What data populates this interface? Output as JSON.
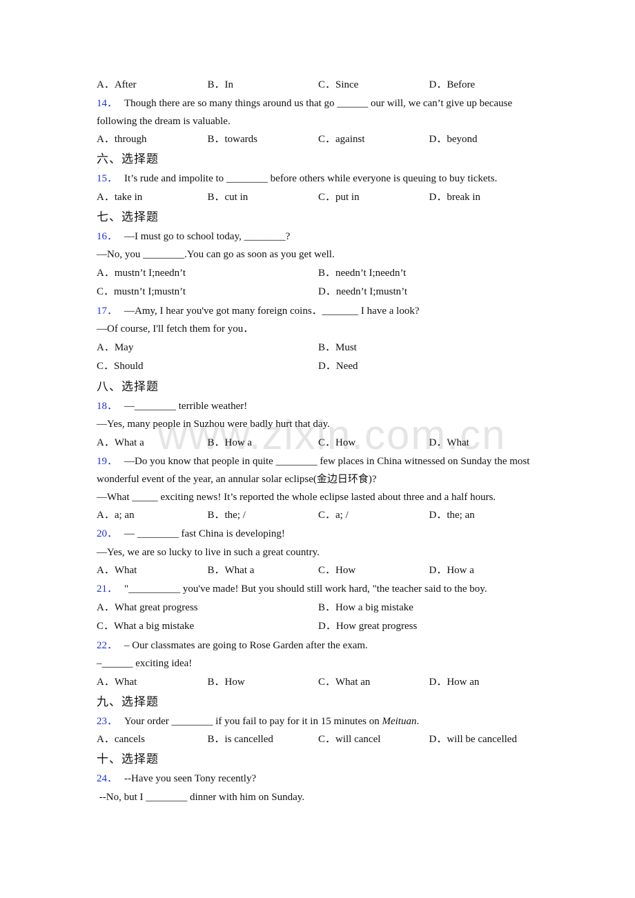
{
  "watermark": "www.zixin.com.cn",
  "q13_options": [
    "A．After",
    "B．In",
    "C．Since",
    "D．Before"
  ],
  "sections": {
    "six": "六、选择题",
    "seven": "七、选择题",
    "eight": "八、选择题",
    "nine": "九、选择题",
    "ten": "十、选择题"
  },
  "questions": {
    "q14": {
      "num": "14．",
      "text": "Though there are so many things around us that go ______ our will, we can’t give up because following the dream is valuable.",
      "options": [
        "A．through",
        "B．towards",
        "C．against",
        "D．beyond"
      ]
    },
    "q15": {
      "num": "15．",
      "text": "It’s rude and impolite to ________ before others while everyone is queuing to buy tickets.",
      "options": [
        "A．take in",
        "B．cut in",
        "C．put in",
        "D．break in"
      ]
    },
    "q16": {
      "num": "16．",
      "line1": "—I must go to school today, ________?",
      "line2": "—No, you ________.You can go as soon as you get well.",
      "options": [
        "A．mustn’t I;needn’t",
        "B．needn’t I;needn’t",
        "C．mustn’t I;mustn’t",
        "D．needn’t I;mustn’t"
      ]
    },
    "q17": {
      "num": "17．",
      "line1": "—Amy, I hear you've got many foreign coins．_______ I have a look?",
      "line2": "—Of course, I'll fetch them for you．",
      "options": [
        "A．May",
        "B．Must",
        "C．Should",
        "D．Need"
      ]
    },
    "q18": {
      "num": "18．",
      "line1": "—________ terrible weather!",
      "line2": "—Yes, many people in Suzhou were badly hurt that day.",
      "options": [
        "A．What a",
        "B．How a",
        "C．How",
        "D．What"
      ]
    },
    "q19": {
      "num": "19．",
      "line1": "—Do you know that people in quite ________ few places in China witnessed on Sunday the most wonderful event of the year, an annular solar eclipse(金边日环食)?",
      "line2": "—What _____ exciting news! It’s reported the whole eclipse lasted about three and a half hours.",
      "options": [
        "A．a; an",
        "B．the; /",
        "C．a; /",
        "D．the; an"
      ]
    },
    "q20": {
      "num": "20．",
      "line1": "— ________ fast China is developing!",
      "line2": "—Yes, we are so lucky to live in such a great country.",
      "options": [
        "A．What",
        "B．What a",
        "C．How",
        "D．How a"
      ]
    },
    "q21": {
      "num": "21．",
      "line1": "\"__________ you've made! But you should still work hard, \"the teacher said to the boy.",
      "options": [
        "A．What great progress",
        "B．How a big mistake",
        "C．What a big mistake",
        "D．How great progress"
      ]
    },
    "q22": {
      "num": "22．",
      "line1": "– Our classmates are going to Rose Garden after the exam.",
      "line2": "–______ exciting idea!",
      "options": [
        "A．What",
        "B．How",
        "C．What an",
        "D．How an"
      ]
    },
    "q23": {
      "num": "23．",
      "text_before": "Your order ________ if you fail to pay for it in 15 minutes on ",
      "text_italic": "Meituan",
      "text_after": ".",
      "options": [
        "A．cancels",
        "B．is cancelled",
        "C．will cancel",
        "D．will be cancelled"
      ]
    },
    "q24": {
      "num": "24．",
      "line1": "--Have you seen Tony recently?",
      "line2": " --No, but I ________ dinner with him on Sunday."
    }
  }
}
